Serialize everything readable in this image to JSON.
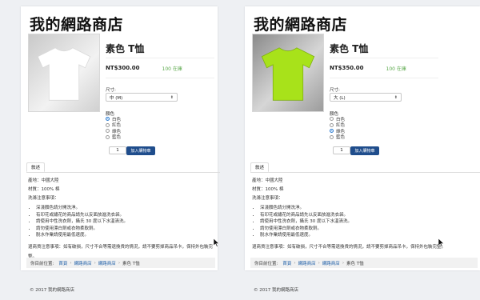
{
  "store_title": "我的網路商店",
  "size_label": "尺寸:",
  "color_label": "顏色",
  "color_options": [
    "白色",
    "紅色",
    "綠色",
    "藍色"
  ],
  "quantity": "1",
  "add_to_cart_label": "加入購物車",
  "tab_label": "敘述",
  "description": {
    "origin": "產地：中國大陸",
    "material": "材質：100% 棉",
    "wash_heading": "洗滌注意事項：",
    "wash_items": [
      "深淺顏色請分開洗淨。",
      "有印花或繡花的商品請先以反面放進洗衣袋。",
      "請使用中性洗衣劑，攝氏 30 度以下水溫清洗。",
      "請勿使用漂白劑或衣物柔軟劑。",
      "脫水作業請使用最低速度。"
    ],
    "return_notice": "退商貨注意事項：如有破損，尺寸不合等需退換貨的情況，請不要剪掉商品吊卡，保持外包裝完整。"
  },
  "breadcrumb": {
    "prefix": "你目前位置:",
    "links": [
      "首頁",
      "網路商店",
      "網路商店"
    ],
    "current": "素色 T恤"
  },
  "footer": "© 2017 我的網路商店",
  "products": [
    {
      "name": "素色 T恤",
      "price": "NT$300.00",
      "stock": "100 在庫",
      "size_selected": "中 (M)",
      "selected_color": 0,
      "shirt_color": "#ffffff"
    },
    {
      "name": "素色 T恤",
      "price": "NT$350.00",
      "stock": "100 在庫",
      "size_selected": "大 (L)",
      "selected_color": 2,
      "shirt_color": "#a8e21a"
    }
  ],
  "colors": {
    "primary_button": "#1f4d8c",
    "link": "#1f5fa8",
    "stock_green": "#5aa84a",
    "radio_checked": "#3a8ee6"
  }
}
